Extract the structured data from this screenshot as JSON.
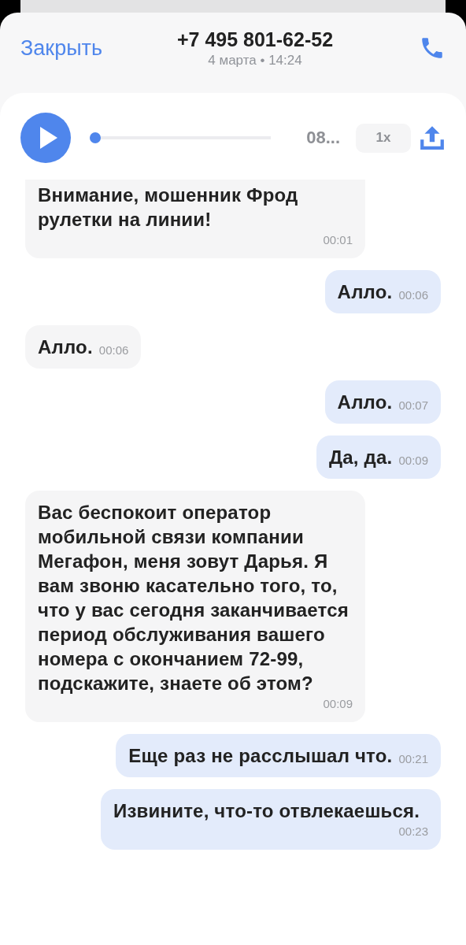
{
  "header": {
    "close": "Закрыть",
    "title": "+7 495 801-62-52",
    "subtitle": "4 марта • 14:24"
  },
  "player": {
    "playing": false,
    "level": 0,
    "time": "08...",
    "speed": "1x"
  },
  "messages": [
    {
      "kind": "incoming",
      "text": "Внимание, мошенник Фрод рулетки на линии!",
      "time": "00:01"
    },
    {
      "kind": "outgoing",
      "text": "Алло.",
      "time": "00:06"
    },
    {
      "kind": "incoming",
      "text": "Алло.",
      "time": "00:06"
    },
    {
      "kind": "outgoing",
      "text": "Алло.",
      "time": "00:07"
    },
    {
      "kind": "outgoing",
      "text": "Да, да.",
      "time": "00:09"
    },
    {
      "kind": "incoming",
      "text": "Вас беспокоит оператор мобильной связи компании Мегафон, меня зовут Дарья. Я вам звоню касательно того, то, что у вас сегодня заканчивается период обслуживания вашего номера с окончанием 72-99, подскажите, знаете об этом?",
      "time": "00:09"
    },
    {
      "kind": "outgoing",
      "text": "Еще раз не расслышал что.",
      "time": "00:21"
    },
    {
      "kind": "outgoing",
      "text": "Извините, что-то отвлекаешься.",
      "time": "00:23"
    }
  ]
}
